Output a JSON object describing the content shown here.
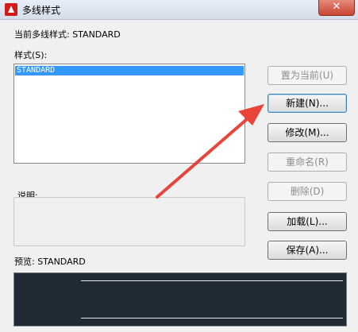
{
  "window": {
    "title": "多线样式",
    "close_glyph": "✕"
  },
  "current_style": {
    "text": "当前多线样式: STANDARD"
  },
  "styles": {
    "label": "样式(S):",
    "items": [
      {
        "label": "STANDARD",
        "selected": true
      }
    ]
  },
  "description": {
    "label": "说明:"
  },
  "preview": {
    "label": "预览: STANDARD"
  },
  "buttons": {
    "set_current": "置为当前(U)",
    "new": "新建(N)...",
    "modify": "修改(M)...",
    "rename": "重命名(R)",
    "delete": "删除(D)",
    "load": "加载(L)...",
    "save": "保存(A)..."
  },
  "colors": {
    "selection": "#3399ff",
    "preview_bg": "#1f2a35",
    "annotation_arrow": "#e8443a"
  }
}
